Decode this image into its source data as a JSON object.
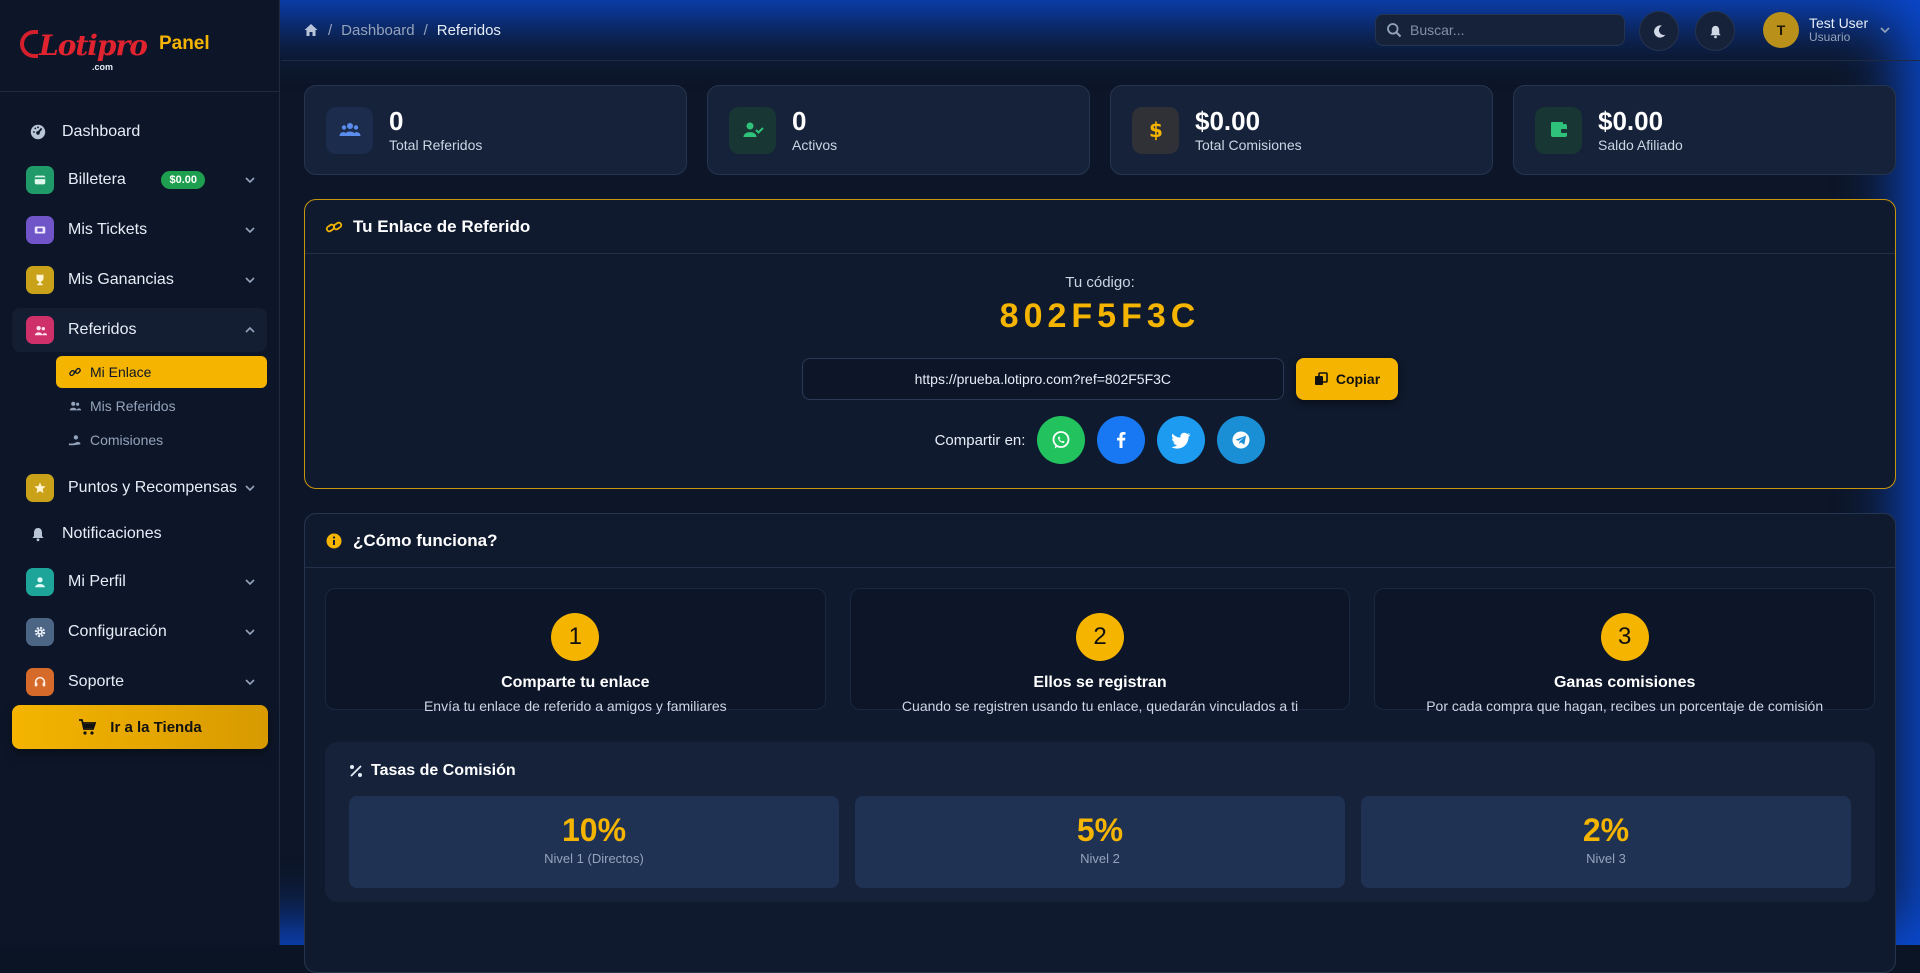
{
  "brand": {
    "name": "Lotipro",
    "suffix": ".com",
    "panel": "Panel"
  },
  "colors": {
    "accent": "#f4b400",
    "background": "#0d1628",
    "card": "#15223a",
    "success": "#1e9e4f"
  },
  "sidebar": {
    "items": [
      {
        "label": "Dashboard",
        "icon": "dashboard-gauge-icon"
      },
      {
        "label": "Billetera",
        "icon": "wallet-icon",
        "badge": "$0.00"
      },
      {
        "label": "Mis Tickets",
        "icon": "ticket-icon"
      },
      {
        "label": "Mis Ganancias",
        "icon": "trophy-icon"
      },
      {
        "label": "Referidos",
        "icon": "users-icon"
      },
      {
        "label": "Puntos y Recompensas",
        "icon": "star-icon"
      },
      {
        "label": "Notificaciones",
        "icon": "bell-icon"
      },
      {
        "label": "Mi Perfil",
        "icon": "user-icon"
      },
      {
        "label": "Configuración",
        "icon": "gear-icon"
      },
      {
        "label": "Soporte",
        "icon": "headset-icon"
      }
    ],
    "sub_items": [
      {
        "label": "Mi Enlace",
        "icon": "link-icon"
      },
      {
        "label": "Mis Referidos",
        "icon": "users-icon"
      },
      {
        "label": "Comisiones",
        "icon": "hand-coin-icon"
      }
    ],
    "shop_button": "Ir a la Tienda"
  },
  "topbar": {
    "breadcrumb": [
      "Dashboard",
      "Referidos"
    ],
    "search_placeholder": "Buscar...",
    "user_initial": "T",
    "user_name": "Test User",
    "user_role": "Usuario"
  },
  "stats": [
    {
      "value": "0",
      "label": "Total Referidos",
      "icon": "users-icon"
    },
    {
      "value": "0",
      "label": "Activos",
      "icon": "user-check-icon"
    },
    {
      "value": "$0.00",
      "label": "Total Comisiones",
      "icon": "dollar-icon"
    },
    {
      "value": "$0.00",
      "label": "Saldo Afiliado",
      "icon": "wallet-icon"
    }
  ],
  "referral": {
    "title": "Tu Enlace de Referido",
    "code_label": "Tu código:",
    "code": "802F5F3C",
    "link": "https://prueba.lotipro.com?ref=802F5F3C",
    "copy_label": "Copiar",
    "share_label": "Compartir en:"
  },
  "how": {
    "title": "¿Cómo funciona?",
    "steps": [
      {
        "num": "1",
        "title": "Comparte tu enlace",
        "desc": "Envía tu enlace de referido a amigos y familiares"
      },
      {
        "num": "2",
        "title": "Ellos se registran",
        "desc": "Cuando se registren usando tu enlace, quedarán vinculados a ti"
      },
      {
        "num": "3",
        "title": "Ganas comisiones",
        "desc": "Por cada compra que hagan, recibes un porcentaje de comisión"
      }
    ]
  },
  "rates": {
    "title": "Tasas de Comisión",
    "items": [
      {
        "value": "10%",
        "label": "Nivel 1 (Directos)"
      },
      {
        "value": "5%",
        "label": "Nivel 2"
      },
      {
        "value": "2%",
        "label": "Nivel 3"
      }
    ]
  }
}
